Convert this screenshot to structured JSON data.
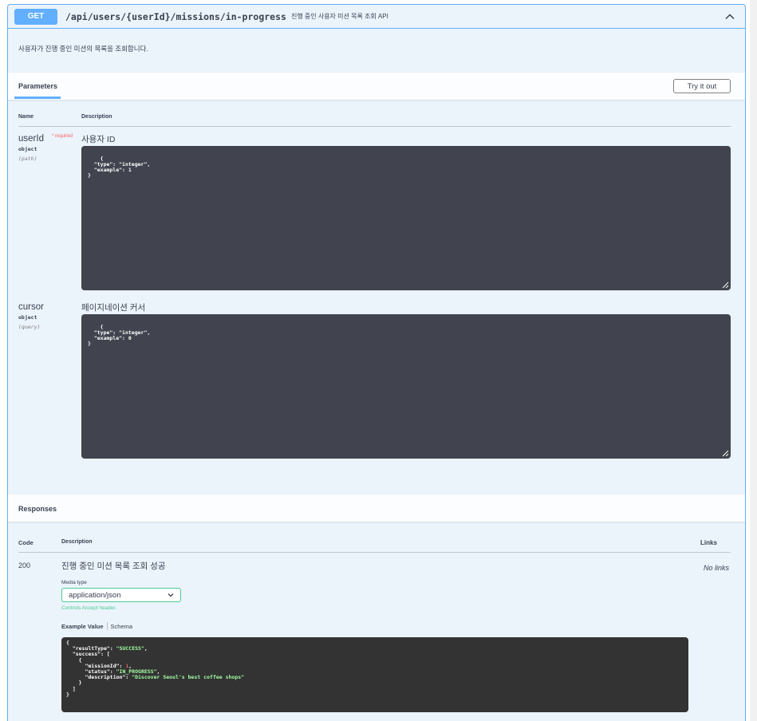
{
  "operation": {
    "method": "GET",
    "path": "/api/users/{userId}/missions/in-progress",
    "summary": "진행 중인 사용자 미션 목록 조회 API",
    "description": "사용자가 진행 중인 미션의 목록을 조회합니다."
  },
  "parameters": {
    "title": "Parameters",
    "try_label": "Try it out",
    "col_name": "Name",
    "col_description": "Description",
    "items": [
      {
        "name": "userId",
        "required": "* required",
        "type": "object",
        "in": "(path)",
        "description": "사용자 ID",
        "schema": "{\n  \"type\": \"integer\",\n  \"example\": 1\n}"
      },
      {
        "name": "cursor",
        "type": "object",
        "in": "(query)",
        "description": "페이지네이션 커서",
        "schema": "{\n  \"type\": \"integer\",\n  \"example\": 0\n}"
      }
    ]
  },
  "responses": {
    "title": "Responses",
    "col_code": "Code",
    "col_description": "Description",
    "col_links": "Links",
    "items": [
      {
        "code": "200",
        "description": "진행 중인 미션 목록 조회 성공",
        "media_type_label": "Media type",
        "media_type": "application/json",
        "accept_note": "Controls Accept header.",
        "tab_example": "Example Value",
        "tab_schema": "Schema",
        "links": "No links",
        "example": {
          "resultType": "SUCCESS",
          "missionId": "1",
          "status": "IN_PROGRESS",
          "description": "Discover Seoul's best coffee shops"
        }
      }
    ]
  },
  "colors": {
    "get": "#61affe",
    "block_bg": "#ebf3fb",
    "code_bg": "#41444e",
    "response_code_bg": "#333333",
    "select_border": "#49cc90",
    "required": "#ff6060"
  }
}
